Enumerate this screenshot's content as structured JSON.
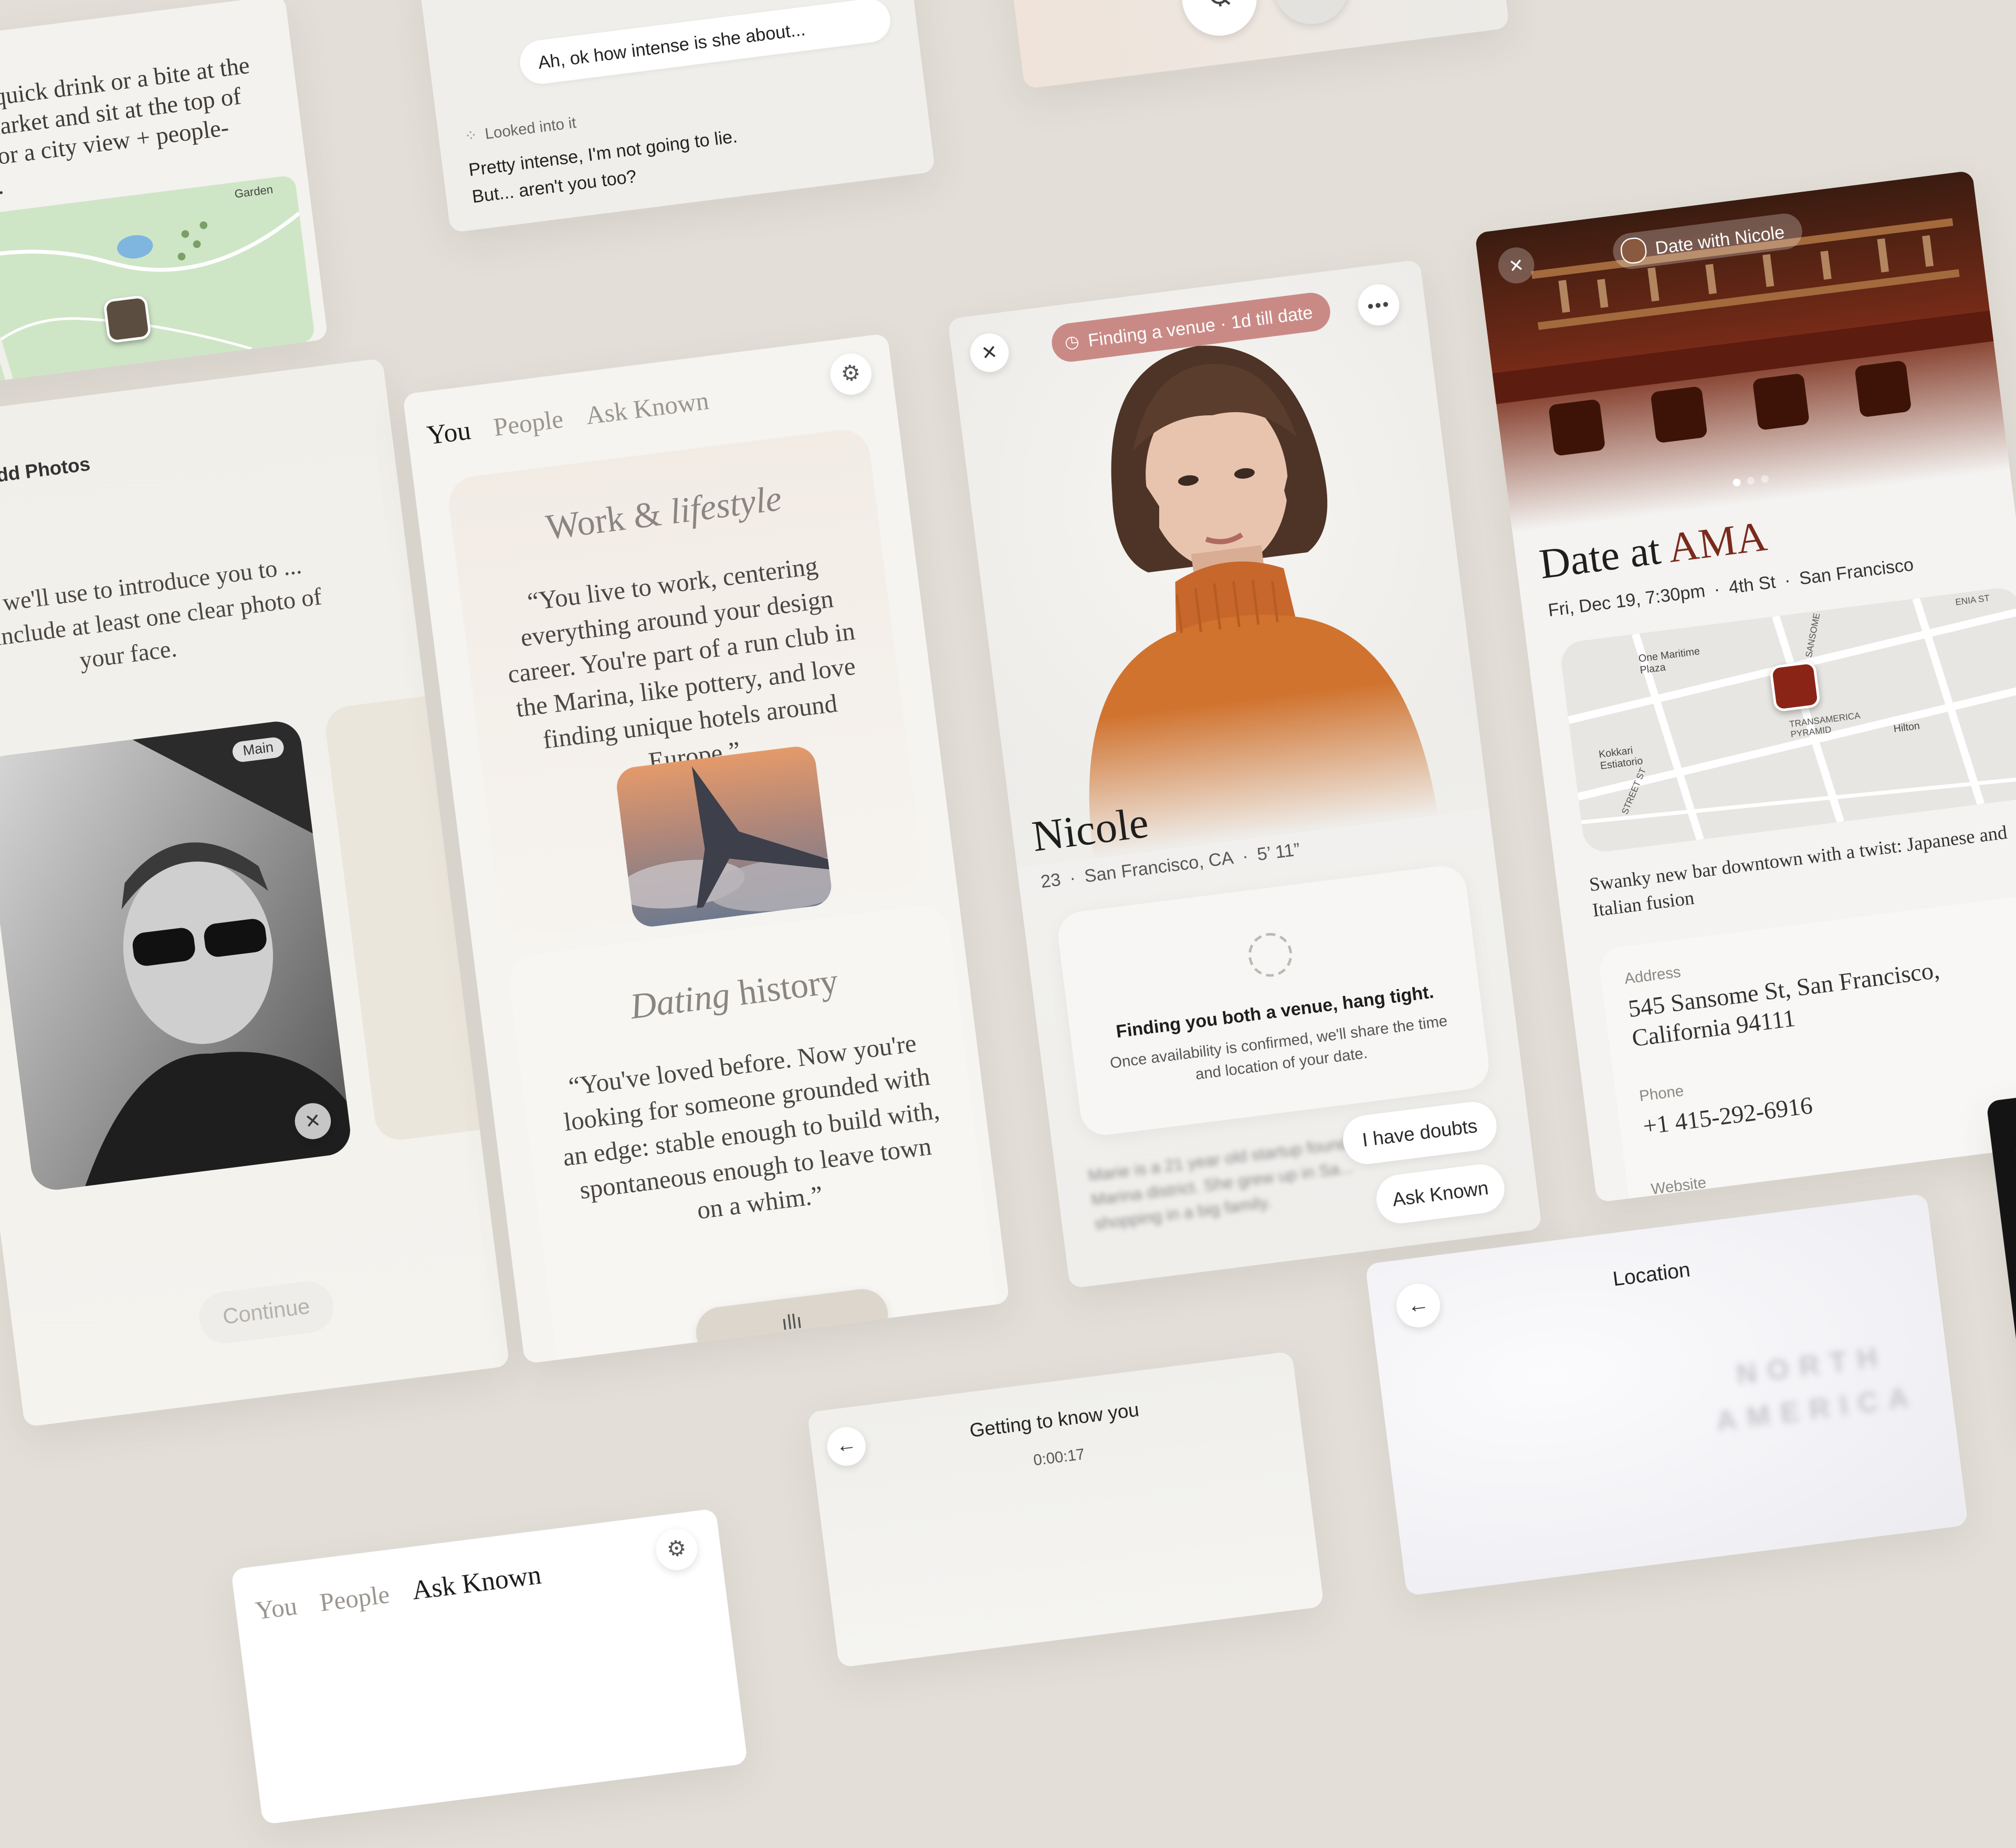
{
  "venue_note_card": {
    "text": "Pick up a quick drink or a bite at the Bi-Rite Market and sit at the top of the park for a city view + people-watching.",
    "map_label": "Garden"
  },
  "chat_card": {
    "user_message": "Ah, ok how intense is she about...",
    "status": "Looked into it",
    "reply": "Pretty intense, I'm not going to lie. But... aren't you too?"
  },
  "call_card": {
    "mute_icon": "mic-off-icon",
    "end_call_icon": "phone-hangup-icon"
  },
  "add_photos": {
    "title": "Add Photos",
    "description": "...otos we'll use to introduce you to ... Please include at least one clear photo of your face.",
    "main_badge": "Main",
    "continue_label": "Continue"
  },
  "profile_summary": {
    "tabs": [
      "You",
      "People",
      "Ask Known"
    ],
    "active_tab": "You",
    "settings_icon": "gear-icon",
    "work_title_plain": "Work &",
    "work_title_italic": "lifestyle",
    "work_quote": "“You live to work, centering everything around your design career. You're part of a run club in the Marina, like pottery, and love finding unique hotels around Europe.”",
    "dating_title_italic": "Dating",
    "dating_title_plain": "history",
    "dating_quote": "“You've loved before. Now you're looking for someone grounded with an edge: stable enough to build with, spontaneous enough to leave town on a whim.”"
  },
  "match_card": {
    "status_badge": "Finding a venue · 1d till date",
    "name": "Nicole",
    "age": "23",
    "location": "San Francisco, CA",
    "height": "5’ 11”",
    "finding_title": "Finding you both a venue, hang tight.",
    "finding_body": "Once availability is confirmed, we'll share the time and location of your date.",
    "blurred_text": "Marie is a 21 year old startup founder... Marina district. She grew up in Sa... shopping in a big family.",
    "doubts_label": "I have doubts",
    "ask_label": "Ask Known"
  },
  "date_card": {
    "header_chip": "Date with Nicole",
    "title_plain": "Date at",
    "title_accent": "AMA",
    "datetime": "Fri, Dec 19, 7:30pm",
    "street": "4th St",
    "city": "San Francisco",
    "map_labels": [
      "One Maritime Plaza",
      "Kokkari Estiatorio",
      "TRANSAMERICA PYRAMID",
      "Hilton",
      "SANSOME",
      "ENIA ST",
      "STREET ST"
    ],
    "description": "Swanky new bar downtown with a twist: Japanese and Italian fusion",
    "address_label": "Address",
    "address": "545 Sansome St, San Francisco, California 94111",
    "phone_label": "Phone",
    "phone": "+1 415-292-6916",
    "website_label": "Website"
  },
  "bottom_tabs_card": {
    "tabs": [
      "You",
      "People",
      "Ask Known"
    ],
    "active_tab": "Ask Known"
  },
  "interview_card": {
    "title": "Getting to know you",
    "timer": "0:00:17"
  },
  "location_card": {
    "title": "Location",
    "map_text": "NORTH AMERICA"
  },
  "colors": {
    "background": "#e3dfd8",
    "badge_red": "#c98a86",
    "accent_brown": "#7a2a1c",
    "sweater": "#d0732f"
  }
}
